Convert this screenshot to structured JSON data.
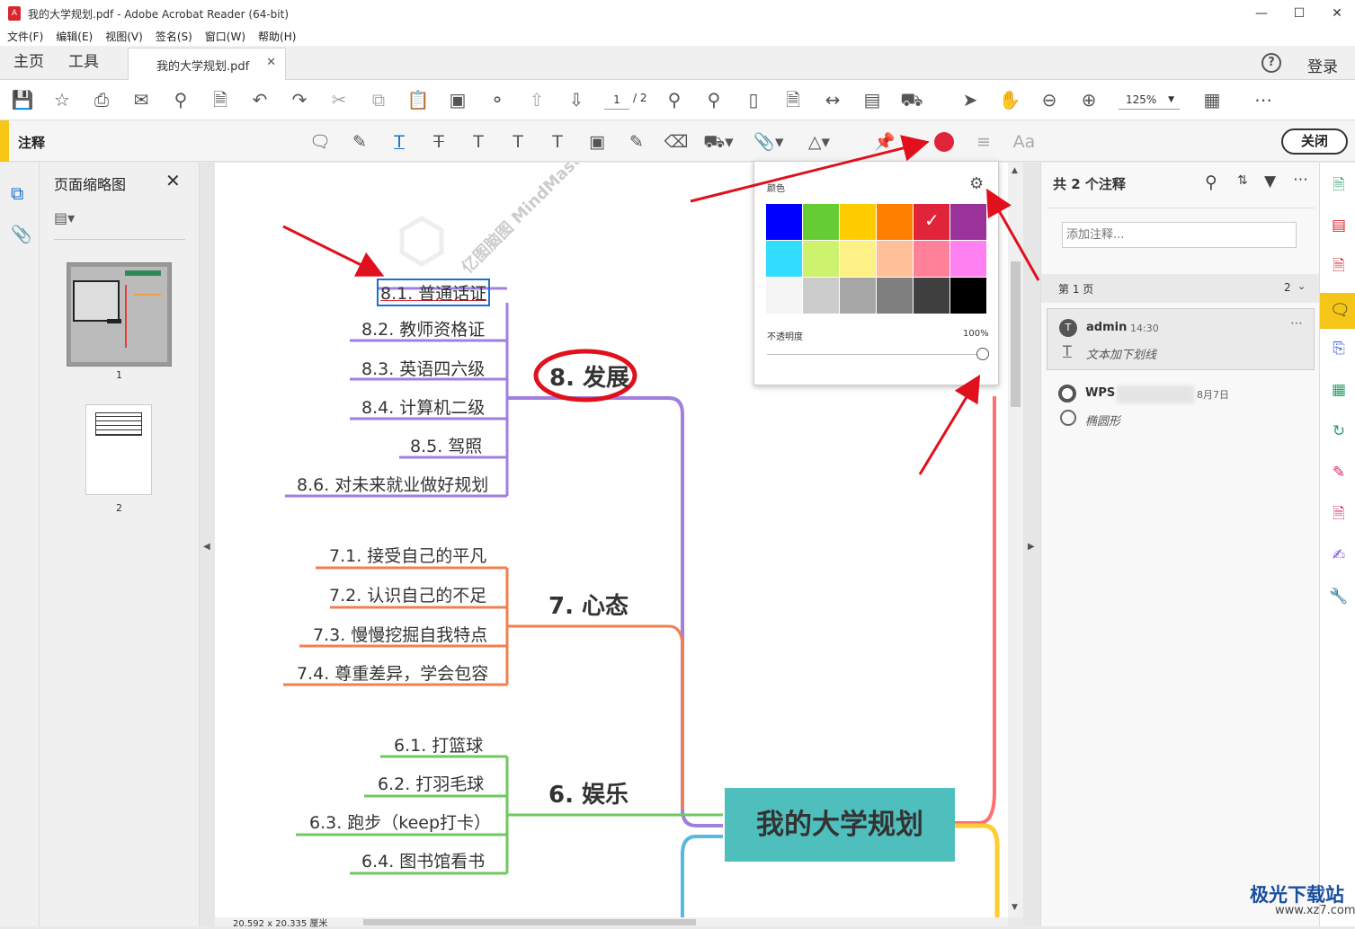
{
  "window": {
    "title": "我的大学规划.pdf - Adobe Acrobat Reader (64-bit)",
    "app_icon": "pdf-icon",
    "minimize": "—",
    "maximize": "☐",
    "close": "✕"
  },
  "menu": [
    "文件(F)",
    "编辑(E)",
    "视图(V)",
    "签名(S)",
    "窗口(W)",
    "帮助(H)"
  ],
  "tabs": {
    "home": "主页",
    "tools": "工具",
    "document": "我的大学规划.pdf",
    "help": "?",
    "login": "登录"
  },
  "toolbar": {
    "page_current": "1",
    "page_total": "/ 2",
    "zoom": "125%"
  },
  "annotation_bar": {
    "label": "注释",
    "text_tool": "Aa",
    "close_label": "关闭",
    "selected_color": "#e0243a"
  },
  "thumbnails": {
    "title": "页面缩略图",
    "pages": [
      "1",
      "2"
    ]
  },
  "color_popup": {
    "label": "颜色",
    "opacity_label": "不透明度",
    "opacity_value": "100%",
    "opacity": 1.0,
    "swatches": [
      "#0000ff",
      "#66cc33",
      "#ffcc00",
      "#ff7f00",
      "#e0243a",
      "#993399",
      "#33ddff",
      "#ccf26e",
      "#fdf085",
      "#ffbf99",
      "#ff8099",
      "#ff80f0",
      "#f5f5f5",
      "#cccccc",
      "#a6a6a6",
      "#7f7f7f",
      "#404040",
      "#000000"
    ],
    "selected_index": 4
  },
  "mindmap": {
    "center": "我的大学规划",
    "branches": [
      {
        "title": "8. 发展",
        "color": "#a07fe0",
        "items": [
          "8.1. 普通话证",
          "8.2. 教师资格证",
          "8.3. 英语四六级",
          "8.4. 计算机二级",
          "8.5. 驾照",
          "8.6. 对未来就业做好规划"
        ]
      },
      {
        "title": "7. 心态",
        "color": "#f08050",
        "items": [
          "7.1. 接受自己的平凡",
          "7.2. 认识自己的不足",
          "7.3. 慢慢挖掘自我特点",
          "7.4. 尊重差异，学会包容"
        ]
      },
      {
        "title": "6. 娱乐",
        "color": "#70c860",
        "items": [
          "6.1. 打篮球",
          "6.2. 打羽毛球",
          "6.3. 跑步（keep打卡）",
          "6.4. 图书馆看书"
        ]
      }
    ],
    "watermark": "亿图脑图 MindMaster",
    "page_size": "20.592 x 20.335 厘米"
  },
  "comments": {
    "summary": "共 2 个注释",
    "search_placeholder": "添加注释...",
    "page_group": "第 1 页",
    "page_count": "2",
    "items": [
      {
        "author": "admin",
        "time": "14:30",
        "text": "文本加下划线"
      },
      {
        "author": "WPS",
        "time": "8月7日",
        "text": "椭圆形"
      }
    ]
  },
  "watermark_site": "极光下载站",
  "watermark_url": "www.xz7.com"
}
